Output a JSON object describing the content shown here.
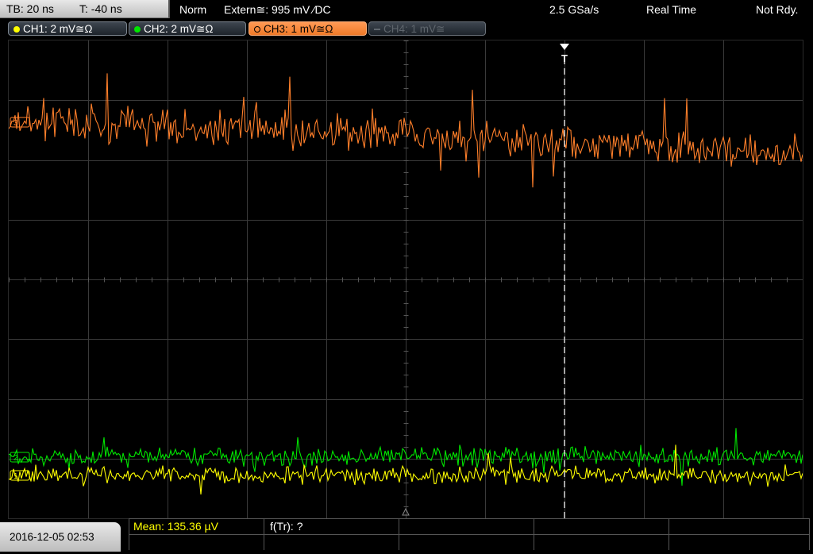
{
  "status_bar": {
    "timebase": "TB: 20 ns",
    "trigger_time": "T: -40 ns",
    "mode": "Norm",
    "trigger_info": "Extern≅: 995 mV ⁄DC",
    "sample_rate": "2.5 GSa/s",
    "acquisition": "Real Time",
    "state": "Not Rdy."
  },
  "channels": [
    {
      "label": "CH1: 2 mV≅Ω",
      "color": "#ffff00",
      "state": "on"
    },
    {
      "label": "CH2: 2 mV≅Ω",
      "color": "#00e600",
      "state": "on"
    },
    {
      "label": "CH3: 1 mV≅Ω",
      "color": "#ff7f2a",
      "state": "selected"
    },
    {
      "label": "CH4: 1 mV≅",
      "color": "#5f666d",
      "state": "off"
    }
  ],
  "screen": {
    "trigger_marker": "T",
    "grid_color": "#3a3a3a",
    "trigger_line_color": "#ffffff"
  },
  "bottom_bar": {
    "datetime": "2016-12-05 02:53",
    "meas1": "Mean: 135.36 µV",
    "meas2": "f(Tr): ?"
  },
  "colors": {
    "ch1": "#ffff00",
    "ch2": "#00e600",
    "ch3": "#ff7f2a"
  }
}
